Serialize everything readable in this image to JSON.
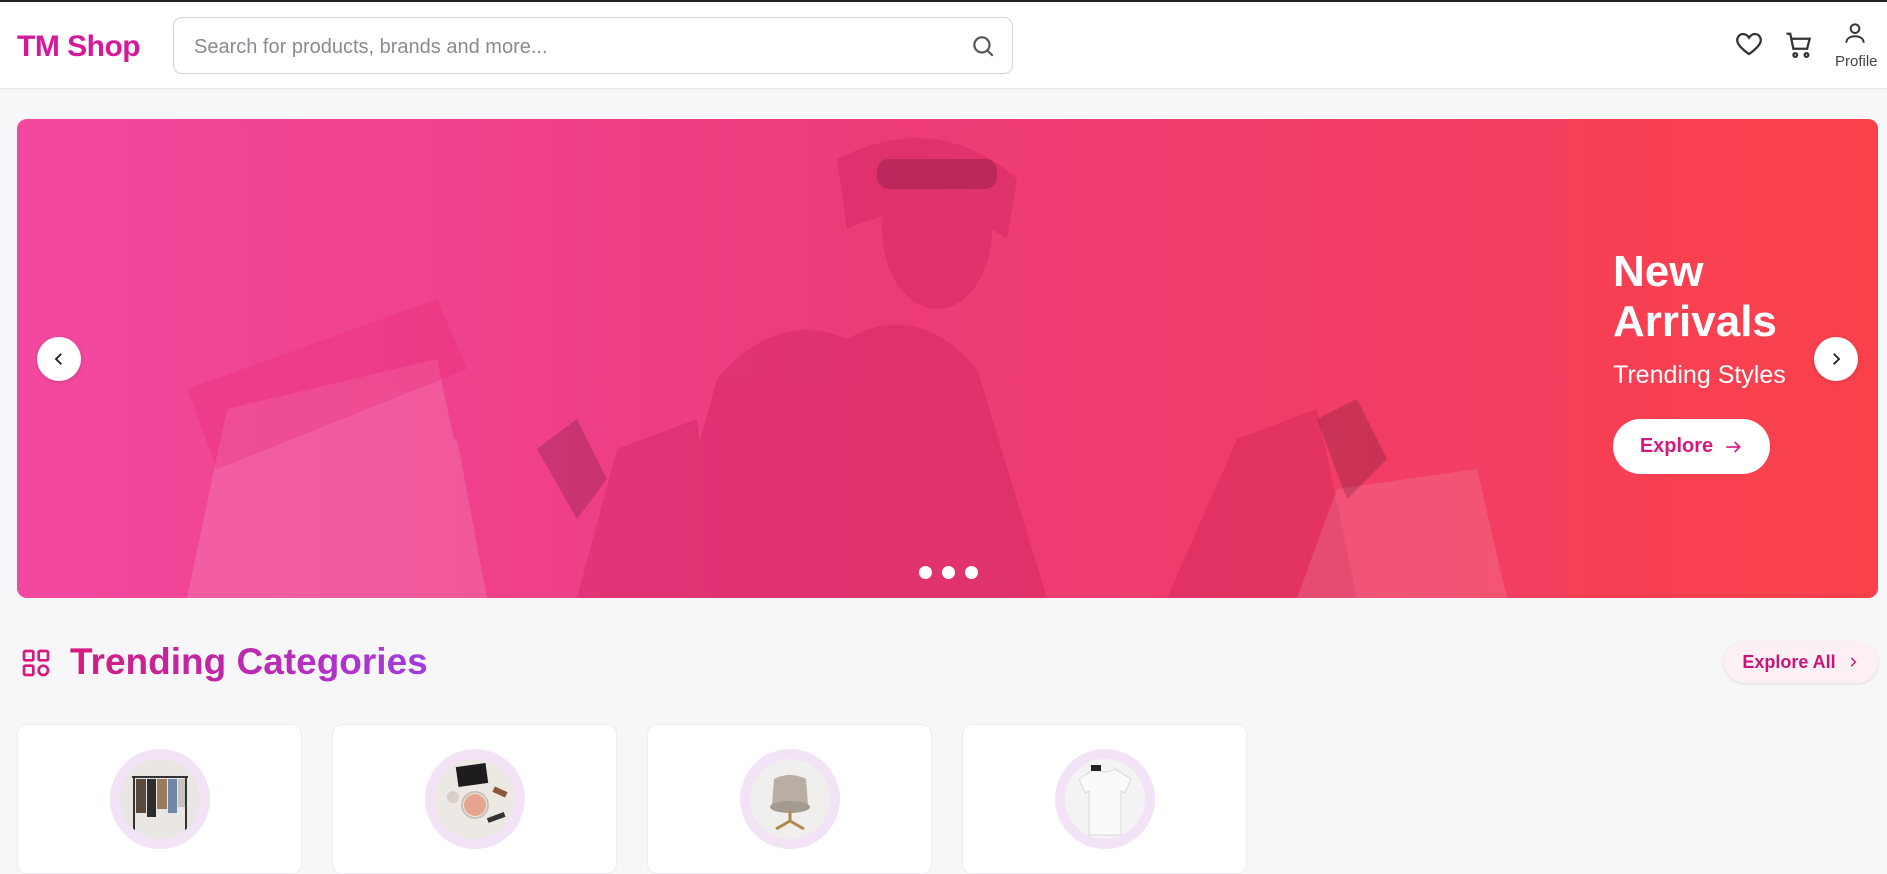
{
  "brand": {
    "name": "TM Shop",
    "color": "#d6199a"
  },
  "search": {
    "placeholder": "Search for products, brands and more..."
  },
  "header_actions": {
    "profile_label": "Profile"
  },
  "hero": {
    "title": "New Arrivals",
    "subtitle": "Trending Styles",
    "cta_label": "Explore",
    "slides": 3,
    "gradient": [
      "#f2499f",
      "#fb4347"
    ]
  },
  "section": {
    "title": "Trending Categories",
    "explore_all_label": "Explore All"
  },
  "categories": [
    {
      "icon": "clothing-rack-image"
    },
    {
      "icon": "cosmetics-image"
    },
    {
      "icon": "chair-image"
    },
    {
      "icon": "tshirt-image"
    }
  ]
}
